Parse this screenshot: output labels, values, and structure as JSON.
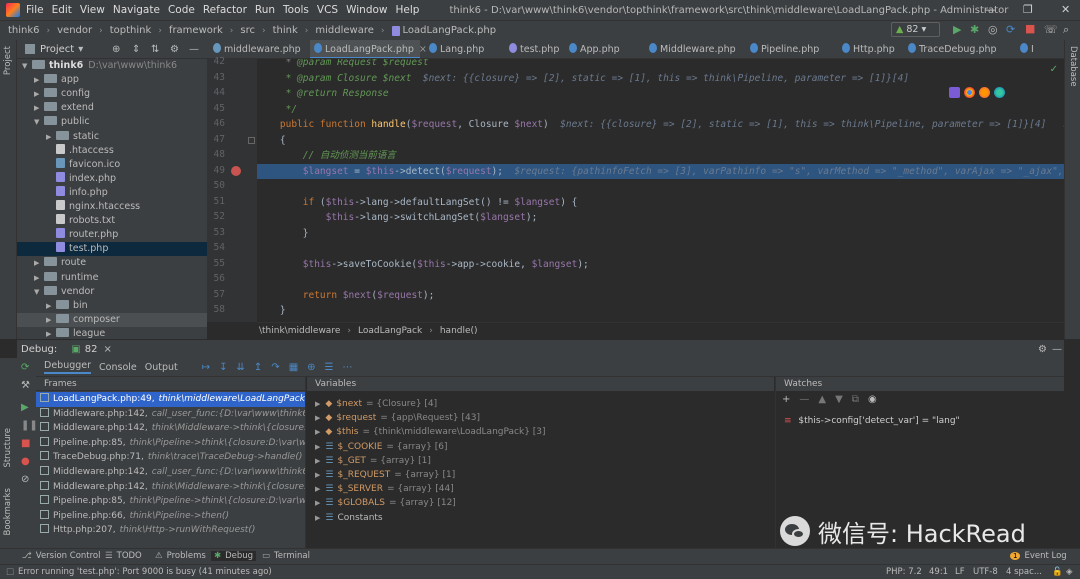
{
  "menu": {
    "items": [
      "File",
      "Edit",
      "View",
      "Navigate",
      "Code",
      "Refactor",
      "Run",
      "Tools",
      "VCS",
      "Window",
      "Help"
    ],
    "title": "think6 - D:\\var\\www\\think6\\vendor\\topthink\\framework\\src\\think\\middleware\\LoadLangPack.php - Administrator"
  },
  "nav": {
    "crumbs": [
      "think6",
      "vendor",
      "topthink",
      "framework",
      "src",
      "think",
      "middleware",
      "LoadLangPack.php"
    ],
    "run_config": "82"
  },
  "project": {
    "header": "Project",
    "tree": [
      {
        "label": "think6",
        "suffix": "D:\\var\\www\\think6",
        "kind": "folder",
        "open": true,
        "indent": 0
      },
      {
        "label": "app",
        "kind": "folder",
        "indent": 1
      },
      {
        "label": "config",
        "kind": "folder",
        "indent": 1
      },
      {
        "label": "extend",
        "kind": "folder",
        "indent": 1
      },
      {
        "label": "public",
        "kind": "folder",
        "open": true,
        "indent": 1
      },
      {
        "label": "static",
        "kind": "folder",
        "indent": 2
      },
      {
        "label": ".htaccess",
        "kind": "file",
        "color": "#c9c9c9",
        "indent": 2
      },
      {
        "label": "favicon.ico",
        "kind": "file",
        "color": "#6897bb",
        "indent": 2
      },
      {
        "label": "index.php",
        "kind": "file",
        "color": "#8f8cdf",
        "indent": 2
      },
      {
        "label": "info.php",
        "kind": "file",
        "color": "#8f8cdf",
        "indent": 2
      },
      {
        "label": "nginx.htaccess",
        "kind": "file",
        "color": "#c9c9c9",
        "indent": 2
      },
      {
        "label": "robots.txt",
        "kind": "file",
        "color": "#c9c9c9",
        "indent": 2
      },
      {
        "label": "router.php",
        "kind": "file",
        "color": "#8f8cdf",
        "indent": 2
      },
      {
        "label": "test.php",
        "kind": "file",
        "color": "#8f8cdf",
        "indent": 2,
        "selected": true
      },
      {
        "label": "route",
        "kind": "folder",
        "indent": 1
      },
      {
        "label": "runtime",
        "kind": "folder",
        "indent": 1
      },
      {
        "label": "vendor",
        "kind": "folder",
        "open": true,
        "indent": 1
      },
      {
        "label": "bin",
        "kind": "folder",
        "indent": 2
      },
      {
        "label": "composer",
        "kind": "folder",
        "indent": 2,
        "highlight": true
      },
      {
        "label": "league",
        "kind": "folder",
        "indent": 2
      }
    ]
  },
  "tabs": [
    {
      "label": "middleware.php",
      "active": false
    },
    {
      "label": "LoadLangPack.php",
      "active": true
    },
    {
      "label": "Lang.php",
      "active": false
    },
    {
      "label": "test.php",
      "active": false
    },
    {
      "label": "App.php",
      "active": false
    },
    {
      "label": "Middleware.php",
      "active": false
    },
    {
      "label": "Pipeline.php",
      "active": false
    },
    {
      "label": "Http.php",
      "active": false
    },
    {
      "label": "TraceDebug.php",
      "active": false
    },
    {
      "label": "I",
      "active": false
    }
  ],
  "editor": {
    "lines": [
      {
        "n": "42",
        "segs": [
          [
            "strc",
            "     * "
          ],
          [
            "cm",
            "@param Request $request"
          ]
        ]
      },
      {
        "n": "43",
        "segs": [
          [
            "cm",
            "     * @param Closure $next"
          ],
          [
            "hint",
            "  $next: {{closure} => [2], static => [1], this => think\\Pipeline, parameter => [1]}[4]"
          ]
        ]
      },
      {
        "n": "44",
        "segs": [
          [
            "cm",
            "     * @return Response"
          ]
        ]
      },
      {
        "n": "45",
        "segs": [
          [
            "cm",
            "     */"
          ]
        ]
      },
      {
        "n": "46",
        "segs": [
          [
            "kw",
            "    public function "
          ],
          [
            "fn",
            "handle"
          ],
          [
            "tx",
            "("
          ],
          [
            "vr",
            "$request"
          ],
          [
            "tx",
            ", Closure "
          ],
          [
            "vr",
            "$next"
          ],
          [
            "tx",
            ")"
          ],
          [
            "hint",
            "  $next: {{closure} => [2], static => [1], this => think\\Pipeline, parameter => [1]}[4]   $r"
          ]
        ]
      },
      {
        "n": "47",
        "segs": [
          [
            "tx",
            "    {"
          ]
        ]
      },
      {
        "n": "48",
        "segs": [
          [
            "cm",
            "        // 自动侦测当前语言"
          ]
        ]
      },
      {
        "n": "49",
        "segs": [
          [
            "vr",
            "        $langset"
          ],
          [
            "tx",
            " = "
          ],
          [
            "vr",
            "$this"
          ],
          [
            "tx",
            "->detect("
          ],
          [
            "vr",
            "$request"
          ],
          [
            "tx",
            ");"
          ],
          [
            "hint",
            "  $request: {pathinfoFetch => [3], varPathinfo => \"s\", varMethod => \"_method\", varAjax => \"_ajax\","
          ]
        ]
      },
      {
        "n": "50",
        "segs": [
          [
            "tx",
            ""
          ]
        ]
      },
      {
        "n": "51",
        "segs": [
          [
            "kw",
            "        if "
          ],
          [
            "tx",
            "("
          ],
          [
            "vr",
            "$this"
          ],
          [
            "tx",
            "->lang->defaultLangSet() != "
          ],
          [
            "vr",
            "$langset"
          ],
          [
            "tx",
            ") {"
          ]
        ]
      },
      {
        "n": "52",
        "segs": [
          [
            "vr",
            "            $this"
          ],
          [
            "tx",
            "->lang->switchLangSet("
          ],
          [
            "vr",
            "$langset"
          ],
          [
            "tx",
            ");"
          ]
        ]
      },
      {
        "n": "53",
        "segs": [
          [
            "tx",
            "        }"
          ]
        ]
      },
      {
        "n": "54",
        "segs": [
          [
            "tx",
            ""
          ]
        ]
      },
      {
        "n": "55",
        "segs": [
          [
            "vr",
            "        $this"
          ],
          [
            "tx",
            "->saveToCookie("
          ],
          [
            "vr",
            "$this"
          ],
          [
            "tx",
            "->app->cookie, "
          ],
          [
            "vr",
            "$langset"
          ],
          [
            "tx",
            ");"
          ]
        ]
      },
      {
        "n": "56",
        "segs": [
          [
            "tx",
            ""
          ]
        ]
      },
      {
        "n": "57",
        "segs": [
          [
            "kw",
            "        return "
          ],
          [
            "vr",
            "$next"
          ],
          [
            "tx",
            "("
          ],
          [
            "vr",
            "$request"
          ],
          [
            "tx",
            ");"
          ]
        ]
      },
      {
        "n": "58",
        "segs": [
          [
            "tx",
            "    }"
          ]
        ]
      }
    ],
    "breadcrumb": [
      "\\think\\middleware",
      "LoadLangPack",
      "handle()"
    ]
  },
  "debug": {
    "label": "Debug:",
    "session": "82",
    "tabs": [
      "Debugger",
      "Console",
      "Output"
    ],
    "frames_header": "Frames",
    "variables_header": "Variables",
    "watches_header": "Watches",
    "frames": [
      {
        "file": "LoadLangPack.php:49,",
        "ctx": "think\\middleware\\LoadLangPack->handle()",
        "sel": true
      },
      {
        "file": "Middleware.php:142,",
        "ctx": "call_user_func:{D:\\var\\www\\think6\\vendor"
      },
      {
        "file": "Middleware.php:142,",
        "ctx": "think\\Middleware->think\\{closure:D:\\var\\www\\th"
      },
      {
        "file": "Pipeline.php:85,",
        "ctx": "think\\Pipeline->think\\{closure:D:\\var\\www\\think6"
      },
      {
        "file": "TraceDebug.php:71,",
        "ctx": "think\\trace\\TraceDebug->handle()"
      },
      {
        "file": "Middleware.php:142,",
        "ctx": "call_user_func:{D:\\var\\www\\think6\\vendor"
      },
      {
        "file": "Middleware.php:142,",
        "ctx": "think\\Middleware->think\\{closure:D:\\var\\www\\th"
      },
      {
        "file": "Pipeline.php:85,",
        "ctx": "think\\Pipeline->think\\{closure:D:\\var\\www\\think6"
      },
      {
        "file": "Pipeline.php:66,",
        "ctx": "think\\Pipeline->then()"
      },
      {
        "file": "Http.php:207,",
        "ctx": "think\\Http->runWithRequest()"
      }
    ],
    "variables": [
      {
        "name": "$next",
        "val": "= {Closure} [4]"
      },
      {
        "name": "$request",
        "val": "= {app\\Request} [43]"
      },
      {
        "name": "$this",
        "val": "= {think\\middleware\\LoadLangPack} [3]"
      },
      {
        "name": "$_COOKIE",
        "val": "= {array} [6]"
      },
      {
        "name": "$_GET",
        "val": "= {array} [1]"
      },
      {
        "name": "$_REQUEST",
        "val": "= {array} [1]"
      },
      {
        "name": "$_SERVER",
        "val": "= {array} [44]"
      },
      {
        "name": "$GLOBALS",
        "val": "= {array} [12]"
      },
      {
        "name": "Constants",
        "val": ""
      }
    ],
    "watch": "$this->config['detect_var'] = \"lang\""
  },
  "bottom_tools": {
    "items": [
      "Version Control",
      "TODO",
      "Problems",
      "Debug",
      "Terminal"
    ],
    "event_log": "Event Log",
    "event_count": "1"
  },
  "status": {
    "message": "Error running 'test.php': Port 9000 is busy (41 minutes ago)",
    "php": "PHP: 7.2",
    "pos": "49:1",
    "eol": "LF",
    "enc": "UTF-8",
    "indent": "4 spac..."
  },
  "side_labels": {
    "project": "Project",
    "structure": "Structure",
    "bookmarks": "Bookmarks",
    "database": "Database"
  },
  "watermark": "微信号: HackRead",
  "colors": {
    "selection": "#2f65ca",
    "exec_line": "#2d5580",
    "accent": "#4a88c7"
  }
}
